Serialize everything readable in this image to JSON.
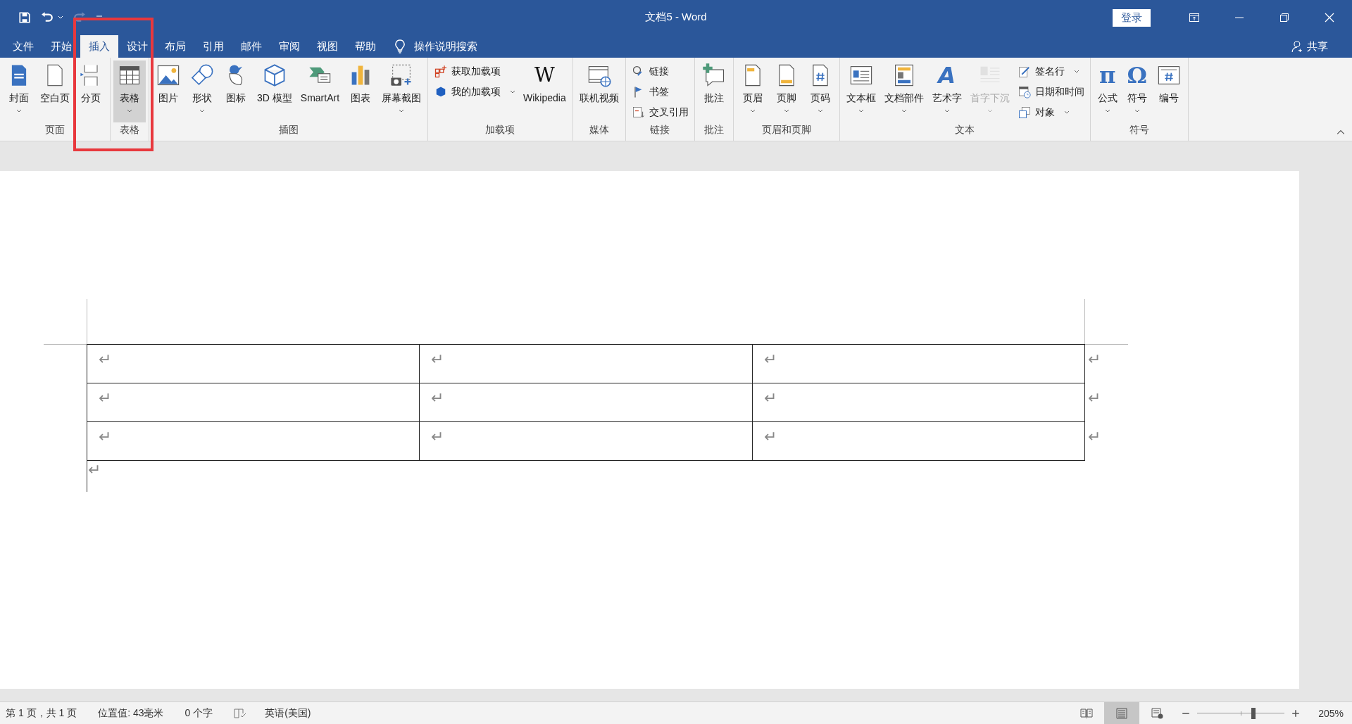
{
  "window": {
    "title": "文档5  -  Word",
    "sign_in": "登录"
  },
  "tabs": [
    {
      "label": "文件",
      "selected": false
    },
    {
      "label": "开始",
      "selected": false
    },
    {
      "label": "插入",
      "selected": true
    },
    {
      "label": "设计",
      "selected": false
    },
    {
      "label": "布局",
      "selected": false
    },
    {
      "label": "引用",
      "selected": false
    },
    {
      "label": "邮件",
      "selected": false
    },
    {
      "label": "审阅",
      "selected": false
    },
    {
      "label": "视图",
      "selected": false
    },
    {
      "label": "帮助",
      "selected": false
    }
  ],
  "tell_me": "操作说明搜索",
  "share": "共享",
  "ribbon": {
    "groups": [
      {
        "label": "页面",
        "items": [
          {
            "kind": "large",
            "label": "封面",
            "dropdown": true,
            "disabled": false,
            "highlighted": false
          },
          {
            "kind": "large",
            "label": "空白页",
            "dropdown": false,
            "disabled": false,
            "highlighted": false
          },
          {
            "kind": "large",
            "label": "分页",
            "dropdown": false,
            "disabled": false,
            "highlighted": false
          }
        ]
      },
      {
        "label": "表格",
        "items": [
          {
            "kind": "large",
            "label": "表格",
            "dropdown": true,
            "disabled": false,
            "highlighted": true
          }
        ]
      },
      {
        "label": "插图",
        "items": [
          {
            "kind": "large",
            "label": "图片",
            "dropdown": false,
            "disabled": false,
            "highlighted": false
          },
          {
            "kind": "large",
            "label": "形状",
            "dropdown": true,
            "disabled": false,
            "highlighted": false
          },
          {
            "kind": "large",
            "label": "图标",
            "dropdown": false,
            "disabled": false,
            "highlighted": false
          },
          {
            "kind": "large",
            "label": "3D 模型",
            "dropdown": false,
            "disabled": false,
            "highlighted": false
          },
          {
            "kind": "large",
            "label": "SmartArt",
            "dropdown": false,
            "disabled": false,
            "highlighted": false
          },
          {
            "kind": "large",
            "label": "图表",
            "dropdown": false,
            "disabled": false,
            "highlighted": false
          },
          {
            "kind": "large",
            "label": "屏幕截图",
            "dropdown": true,
            "disabled": false,
            "highlighted": false
          }
        ]
      },
      {
        "label": "加载项",
        "items": [
          {
            "kind": "small",
            "label": "获取加载项",
            "dropdown": false,
            "disabled": false,
            "highlighted": false
          },
          {
            "kind": "small",
            "label": "我的加载项",
            "dropdown": true,
            "disabled": false,
            "highlighted": false
          },
          {
            "kind": "large",
            "label": "Wikipedia",
            "glyph": "W",
            "dropdown": false,
            "disabled": false,
            "highlighted": false
          }
        ]
      },
      {
        "label": "媒体",
        "items": [
          {
            "kind": "large",
            "label": "联机视频",
            "dropdown": false,
            "disabled": false,
            "highlighted": false
          }
        ]
      },
      {
        "label": "链接",
        "items": [
          {
            "kind": "small",
            "label": "链接",
            "dropdown": false,
            "disabled": false,
            "highlighted": false
          },
          {
            "kind": "small",
            "label": "书签",
            "dropdown": false,
            "disabled": false,
            "highlighted": false
          },
          {
            "kind": "small",
            "label": "交叉引用",
            "dropdown": false,
            "disabled": false,
            "highlighted": false
          }
        ]
      },
      {
        "label": "批注",
        "items": [
          {
            "kind": "large",
            "label": "批注",
            "dropdown": false,
            "disabled": false,
            "highlighted": false
          }
        ]
      },
      {
        "label": "页眉和页脚",
        "items": [
          {
            "kind": "large",
            "label": "页眉",
            "dropdown": true,
            "disabled": false,
            "highlighted": false
          },
          {
            "kind": "large",
            "label": "页脚",
            "dropdown": true,
            "disabled": false,
            "highlighted": false
          },
          {
            "kind": "large",
            "label": "页码",
            "dropdown": true,
            "disabled": false,
            "highlighted": false
          }
        ]
      },
      {
        "label": "文本",
        "items": [
          {
            "kind": "large",
            "label": "文本框",
            "dropdown": true,
            "disabled": false,
            "highlighted": false
          },
          {
            "kind": "large",
            "label": "文档部件",
            "dropdown": true,
            "disabled": false,
            "highlighted": false
          },
          {
            "kind": "large",
            "label": "艺术字",
            "glyph": "A",
            "dropdown": true,
            "disabled": false,
            "highlighted": false
          },
          {
            "kind": "large",
            "label": "首字下沉",
            "dropdown": true,
            "disabled": true,
            "highlighted": false
          },
          {
            "kind": "small",
            "label": "签名行",
            "dropdown": true,
            "disabled": false,
            "highlighted": false
          },
          {
            "kind": "small",
            "label": "日期和时间",
            "dropdown": false,
            "disabled": false,
            "highlighted": false
          },
          {
            "kind": "small",
            "label": "对象",
            "dropdown": true,
            "disabled": false,
            "highlighted": false
          }
        ]
      },
      {
        "label": "符号",
        "items": [
          {
            "kind": "large",
            "label": "公式",
            "glyph": "π",
            "dropdown": true,
            "disabled": false,
            "highlighted": false
          },
          {
            "kind": "large",
            "label": "符号",
            "glyph": "Ω",
            "dropdown": true,
            "disabled": false,
            "highlighted": false
          },
          {
            "kind": "large",
            "label": "编号",
            "dropdown": false,
            "disabled": false,
            "highlighted": false
          }
        ]
      }
    ]
  },
  "document": {
    "table": {
      "rows": [
        [
          "↵",
          "↵",
          "↵"
        ],
        [
          "↵",
          "↵",
          "↵"
        ],
        [
          "↵",
          "↵",
          "↵"
        ]
      ],
      "row_end_marks": [
        "↵",
        "↵",
        "↵"
      ]
    },
    "paragraph_mark": "↵"
  },
  "status_bar": {
    "page": "第 1 页，共 1 页",
    "position": "位置值: 43毫米",
    "words": "0 个字",
    "language": "英语(美国)",
    "views": [
      {
        "selected": false
      },
      {
        "selected": true
      },
      {
        "selected": false
      }
    ],
    "zoom": {
      "level": 0.64,
      "reading": "205%"
    }
  }
}
